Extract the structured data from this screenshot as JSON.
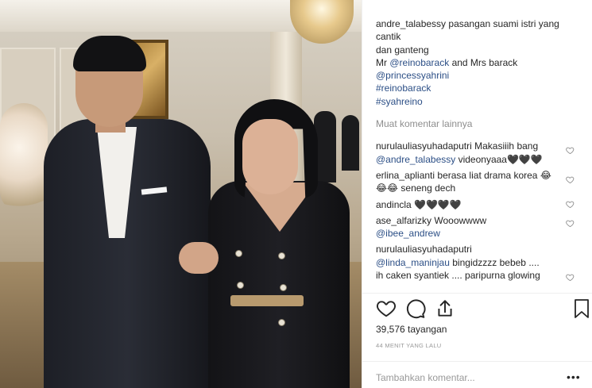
{
  "post": {
    "caption": {
      "username": "andre_talabessy",
      "line1": "pasangan suami istri yang cantik",
      "line2": "dan ganteng",
      "line3_prefix": "Mr",
      "line3_mention": "@reinobarack",
      "line3_suffix": "and Mrs barack",
      "mention2": "@princessyahrini",
      "hashtag1": "#reinobarack",
      "hashtag2": "#syahreino"
    },
    "load_more": "Muat komentar lainnya",
    "comments": [
      {
        "username": "nurulauliasyuhadaputri",
        "text_before": "Makasiiih bang",
        "mention": "@andre_talabessy",
        "text_after": "videonyaaa",
        "emoji": "🖤🖤🖤",
        "heart_icon": "heart-icon"
      },
      {
        "username": "erlina_aplianti",
        "text_before": "berasa liat drama korea",
        "emoji": "😂😂😂",
        "text_after": "seneng dech",
        "heart_icon": "heart-icon"
      },
      {
        "username": "andincla",
        "emoji": "🖤🖤🖤🖤",
        "heart_icon": "heart-icon"
      },
      {
        "username": "ase_alfarizky",
        "text_before": "Wooowwww",
        "mention": "@ibee_andrew",
        "heart_icon": "heart-icon"
      },
      {
        "username": "nurulauliasyuhadaputri",
        "mention": "@linda_maninjau",
        "text_after": "bingidzzzz bebeb ....",
        "line2": "ih caken syantiek .... paripurna glowing",
        "heart_icon": "heart-icon"
      }
    ]
  },
  "actions": {
    "like_icon": "heart-outline-icon",
    "comment_icon": "comment-bubble-icon",
    "share_icon": "share-upload-icon",
    "save_icon": "bookmark-icon"
  },
  "stats": {
    "views": "39,576 tayangan",
    "time_ago": "44 MENIT YANG LALU"
  },
  "add_comment": {
    "placeholder": "Tambahkan komentar...",
    "more_label": "•••"
  },
  "colors": {
    "link": "#2c4f86",
    "muted": "#8e8e8e",
    "text": "#262626"
  }
}
